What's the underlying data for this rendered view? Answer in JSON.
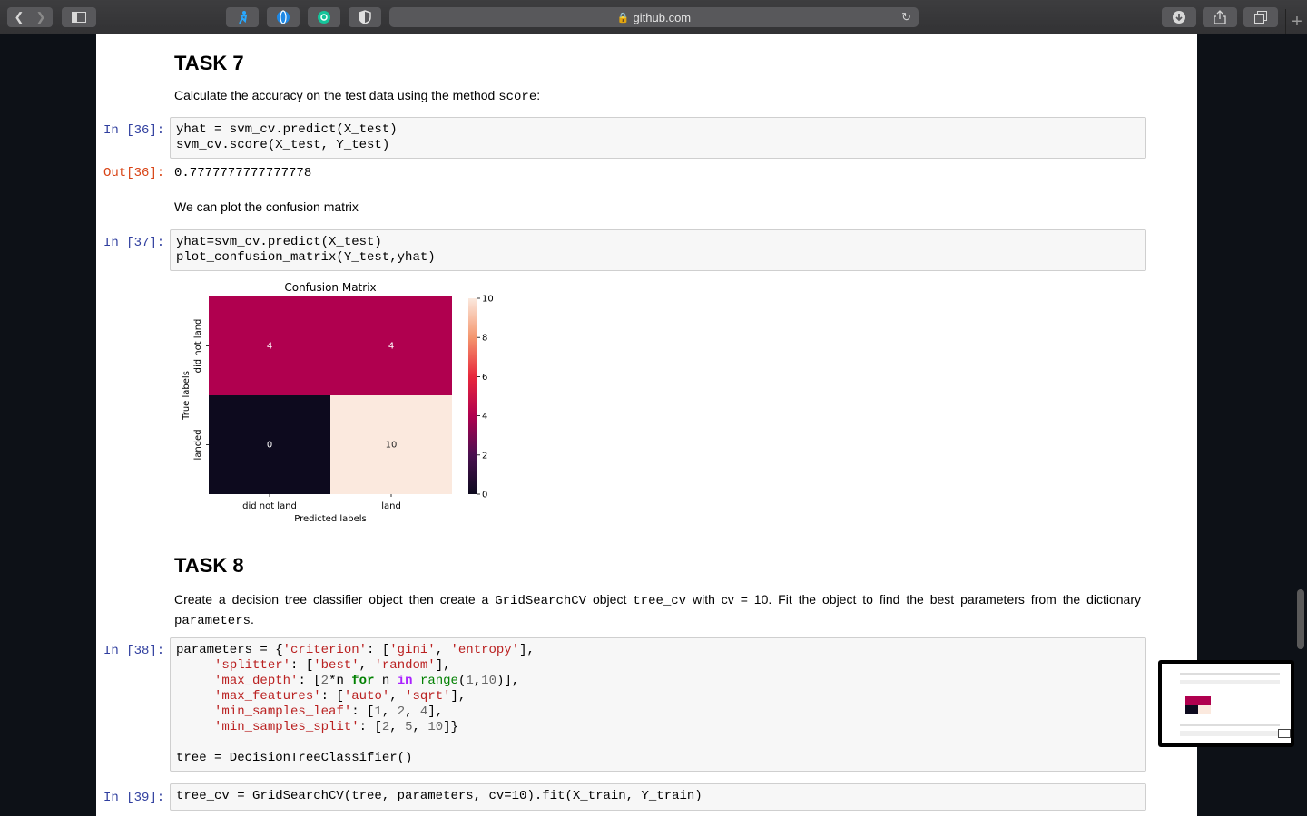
{
  "browser": {
    "address": "github.com",
    "back_icon": "chevron-left-icon",
    "forward_icon": "chevron-right-icon"
  },
  "notebook": {
    "task7": {
      "heading": "TASK 7",
      "text_before": "Calculate the accuracy on the test data using the method ",
      "text_code": "score",
      "text_after": ":"
    },
    "cell36": {
      "prompt_in": "In [36]:",
      "line1": "yhat = svm_cv.predict(X_test)",
      "line2": "svm_cv.score(X_test, Y_test)",
      "prompt_out": "Out[36]:",
      "output": "0.7777777777777778"
    },
    "confusion_text": "We can plot the confusion matrix",
    "cell37": {
      "prompt_in": "In [37]:",
      "line1": "yhat=svm_cv.predict(X_test)",
      "line2": "plot_confusion_matrix(Y_test,yhat)"
    },
    "task8": {
      "heading": "TASK 8",
      "t1": "Create a decision tree classifier object then create a ",
      "c1": "GridSearchCV",
      "t2": " object ",
      "c2": "tree_cv",
      "t3": " with cv = 10. Fit the object to find the best parameters from the dictionary",
      "c3": "parameters",
      "t4": "."
    },
    "cell38": {
      "prompt_in": "In [38]:",
      "tree_line": "tree = DecisionTreeClassifier()"
    },
    "cell39": {
      "prompt_in": "In [39]:",
      "line": "tree_cv = GridSearchCV(tree, parameters, cv=10).fit(X_train, Y_train)"
    }
  },
  "chart_data": {
    "type": "heatmap",
    "title": "Confusion Matrix",
    "xlabel": "Predicted labels",
    "ylabel": "True labels",
    "x_categories": [
      "did not land",
      "land"
    ],
    "y_categories": [
      "did not land",
      "landed"
    ],
    "values": [
      [
        4,
        4
      ],
      [
        0,
        10
      ]
    ],
    "colorbar_ticks": [
      0,
      2,
      4,
      6,
      8,
      10
    ],
    "vmin": 0,
    "vmax": 10
  }
}
